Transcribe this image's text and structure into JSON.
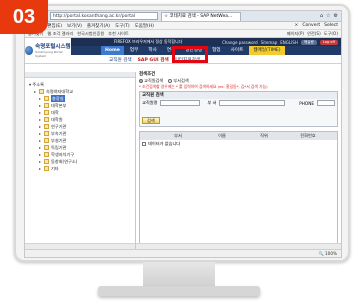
{
  "step_badge": "03",
  "browser": {
    "url": "http://portal.kosanthang.ac.kr/portal",
    "tab_label": "☆ 코테치료 검색 - SAP NetWea...",
    "menu": [
      "파일(F)",
      "편집(E)",
      "보기(V)",
      "즐겨찾기(A)",
      "도구(T)",
      "도움말(H)"
    ],
    "menu_right": [
      "×",
      "Convert",
      "Select"
    ],
    "favorites": [
      "즐겨찾기",
      "웹 조각 갤러리",
      "한국시험인증원",
      "추천 사이트"
    ],
    "favorites_right": [
      "페이지(P)",
      "안전(S)",
      "도구(O)"
    ],
    "status_zoom": "🔍 100%"
  },
  "header": {
    "logo_title": "숙명포털시스템",
    "logo_sub": "Sookmyung Portal System",
    "notice": "FIREFOX 브라우저에서 정상 동작합니다",
    "util": [
      "Change password",
      "Sitemap",
      "ENGLISH"
    ],
    "util_pills": [
      "메실랑",
      "Log off"
    ],
    "gnb": [
      "Home",
      "업무",
      "학사",
      "연구",
      "일반행정",
      "협업",
      "사이트",
      "웹메일(TIME)"
    ],
    "sub_tabs": [
      "교직원 검색",
      "SAP GUI 검색",
      "인터지원검색"
    ]
  },
  "tree": [
    {
      "label": "▾ 주소록",
      "level": "lv1",
      "selected": false
    },
    {
      "label": "숙명여자대학교",
      "level": "lv2",
      "selected": false
    },
    {
      "label": "총장실",
      "level": "lv3",
      "selected": true
    },
    {
      "label": "대학본부",
      "level": "lv3",
      "selected": false
    },
    {
      "label": "대학",
      "level": "lv3",
      "selected": false
    },
    {
      "label": "대학원",
      "level": "lv3",
      "selected": false
    },
    {
      "label": "연구기관",
      "level": "lv3",
      "selected": false
    },
    {
      "label": "부속기관",
      "level": "lv3",
      "selected": false
    },
    {
      "label": "부설기관",
      "level": "lv3",
      "selected": false
    },
    {
      "label": "독립기관",
      "level": "lv3",
      "selected": false
    },
    {
      "label": "학생자치기구",
      "level": "lv3",
      "selected": false
    },
    {
      "label": "동창회(연구소)",
      "level": "lv3",
      "selected": false
    },
    {
      "label": "기타",
      "level": "lv3",
      "selected": false
    }
  ],
  "right": {
    "title": "검색조건",
    "radios": [
      "교직원검색",
      "부서검색"
    ],
    "notice": "* 조건검색할 경우에는 * 를 입력하여 검색하세요 (ex. 홍길동*, 김*서 검색 가능)",
    "search_title": "교직원 검색",
    "field_name": "교직원명",
    "field_dept": "부 서",
    "field_phone": "PHONE",
    "search_button": "검색",
    "grid_cols": [
      "부서",
      "이름",
      "직위",
      "전화번호"
    ],
    "grid_empty": "데이터가 없습니다"
  }
}
